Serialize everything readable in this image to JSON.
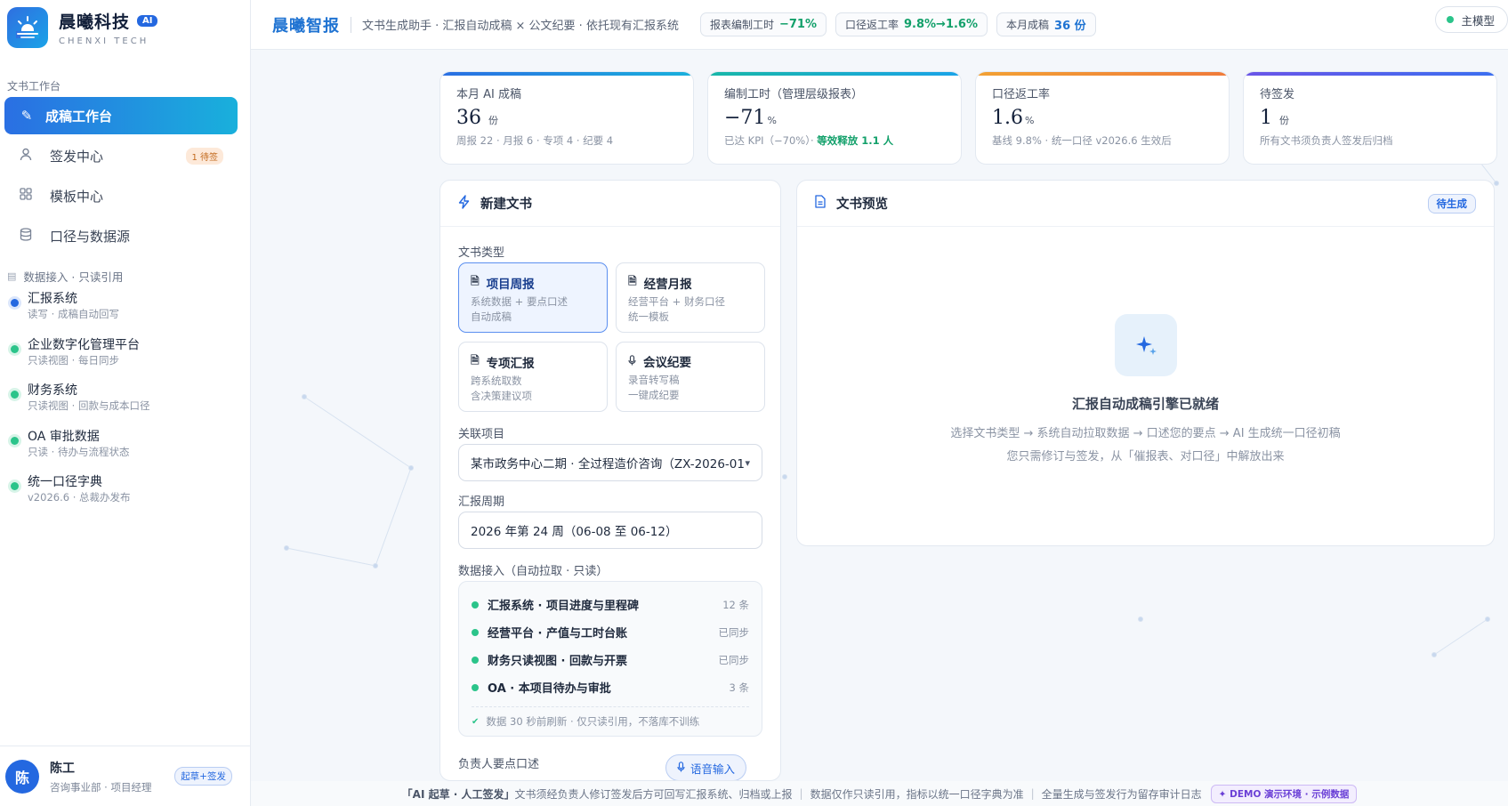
{
  "brand": {
    "name": "晨曦科技",
    "ai_badge": "AI",
    "subtitle": "CHENXI TECH"
  },
  "sidebar": {
    "section_label": "文书工作台",
    "items": [
      {
        "label": "成稿工作台",
        "icon": "pen-icon",
        "active": true
      },
      {
        "label": "签发中心",
        "icon": "user-icon",
        "badge": "1 待签"
      },
      {
        "label": "模板中心",
        "icon": "grid-icon"
      },
      {
        "label": "口径与数据源",
        "icon": "database-icon"
      }
    ],
    "data_section_label": "数据接入 · 只读引用",
    "data_sources": [
      {
        "name": "汇报系统",
        "desc": "读写 · 成稿自动回写",
        "color": "#2468e0"
      },
      {
        "name": "企业数字化管理平台",
        "desc": "只读视图 · 每日同步",
        "color": "#2bc48a"
      },
      {
        "name": "财务系统",
        "desc": "只读视图 · 回款与成本口径",
        "color": "#2bc48a"
      },
      {
        "name": "OA 审批数据",
        "desc": "只读 · 待办与流程状态",
        "color": "#2bc48a"
      },
      {
        "name": "统一口径字典",
        "desc": "v2026.6 · 总裁办发布",
        "color": "#2bc48a"
      }
    ],
    "user": {
      "avatar": "陈",
      "name": "陈工",
      "role": "咨询事业部 · 项目经理",
      "tag": "起草+签发"
    }
  },
  "header": {
    "title": "晨曦智报",
    "desc": "文书生成助手 · 汇报自动成稿 × 公文纪要 · 依托现有汇报系统",
    "pills": [
      {
        "label": "报表编制工时",
        "value": "−71%",
        "color": "g"
      },
      {
        "label": "口径返工率",
        "value": "9.8%→1.6%",
        "color": "g"
      },
      {
        "label": "本月成稿",
        "value": "36 份",
        "color": "bl"
      }
    ],
    "model": "主模型"
  },
  "kpis": [
    {
      "label": "本月 AI 成稿",
      "value": "36",
      "unit": "份",
      "note": "周报 22 · 月报 6 · 专项 4 · 纪要 4"
    },
    {
      "label": "编制工时（管理层级报表）",
      "value": "−71",
      "unit": "%",
      "note": "已达 KPI（−70%）·",
      "note_strong": "等效释放 1.1 人"
    },
    {
      "label": "口径返工率",
      "value": "1.6",
      "unit": "%",
      "note": "基线 9.8% · 统一口径 v2026.6 生效后"
    },
    {
      "label": "待签发",
      "value": "1",
      "unit": "份",
      "note": "所有文书须负责人签发后归档"
    }
  ],
  "new_doc": {
    "title": "新建文书",
    "type_label": "文书类型",
    "types": [
      {
        "title": "项目周报",
        "desc": "系统数据 + 要点口述\n自动成稿",
        "icon": "document-icon",
        "selected": true
      },
      {
        "title": "经营月报",
        "desc": "经营平台 + 财务口径\n统一模板",
        "icon": "document-icon"
      },
      {
        "title": "专项汇报",
        "desc": "跨系统取数\n含决策建议项",
        "icon": "document-icon"
      },
      {
        "title": "会议纪要",
        "desc": "录音转写稿\n一键成纪要",
        "icon": "mic-icon"
      }
    ],
    "project_label": "关联项目",
    "project_value": "某市政务中心二期 · 全过程造价咨询（ZX-2026-01",
    "period_label": "汇报周期",
    "period_value": "2026 年第 24 周（06-08 至 06-12）",
    "data_label": "数据接入（自动拉取 · 只读）",
    "sources": [
      {
        "name": "汇报系统 · 项目进度与里程碑",
        "status": "12 条"
      },
      {
        "name": "经营平台 · 产值与工时台账",
        "status": "已同步"
      },
      {
        "name": "财务只读视图 · 回款与开票",
        "status": "已同步"
      },
      {
        "name": "OA · 本项目待办与审批",
        "status": "3 条"
      }
    ],
    "sources_note": "数据 30 秒前刷新 · 仅只读引用，不落库不训练",
    "next_label": "负责人要点口述",
    "voice_btn": "语音输入"
  },
  "preview": {
    "title": "文书预览",
    "badge": "待生成",
    "empty_title": "汇报自动成稿引擎已就绪",
    "empty_line1": "选择文书类型 → 系统自动拉取数据 → 口述您的要点 → AI 生成统一口径初稿",
    "empty_line2": "您只需修订与签发，从「催报表、对口径」中解放出来"
  },
  "footer": {
    "part1_strong": "「AI 起草 · 人工签发」",
    "part1": "文书须经负责人修订签发后方可回写汇报系统、归档或上报",
    "part2": "数据仅作只读引用，指标以统一口径字典为准",
    "part3": "全量生成与签发行为留存审计日志",
    "demo": "✦ DEMO 演示环境 · 示例数据"
  }
}
